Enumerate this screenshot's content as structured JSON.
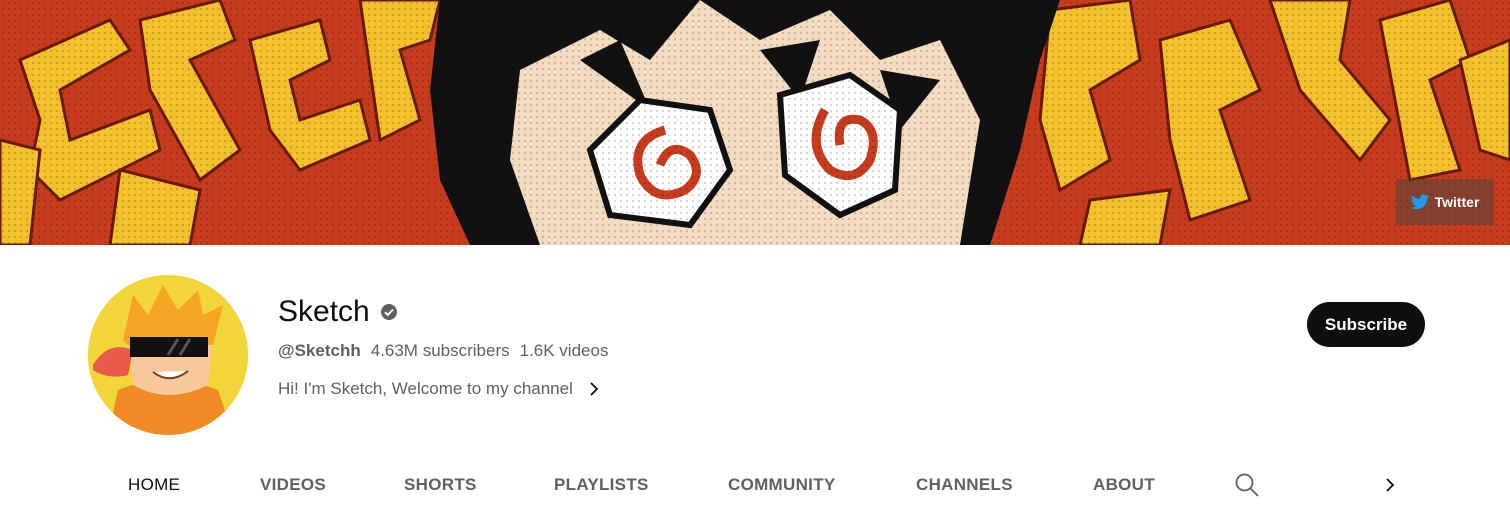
{
  "banner": {
    "twitter_label": "Twitter",
    "colors": {
      "red": "#c83c1e",
      "yellow": "#f3c12c",
      "black": "#111111",
      "skin": "#f4dcc0"
    }
  },
  "channel": {
    "name": "Sketch",
    "handle": "@Sketchh",
    "subscribers": "4.63M subscribers",
    "videos": "1.6K videos",
    "description": "Hi! I'm Sketch, Welcome to my channel",
    "verified_icon": "verified-check-icon"
  },
  "subscribe": {
    "label": "Subscribe",
    "color": "#0f0f0f"
  },
  "tabs": [
    {
      "label": "HOME",
      "active": true
    },
    {
      "label": "VIDEOS"
    },
    {
      "label": "SHORTS"
    },
    {
      "label": "PLAYLISTS"
    },
    {
      "label": "COMMUNITY"
    },
    {
      "label": "CHANNELS"
    },
    {
      "label": "ABOUT"
    }
  ],
  "tab_icons": {
    "search": "search-icon",
    "next": "chevron-right-icon"
  }
}
